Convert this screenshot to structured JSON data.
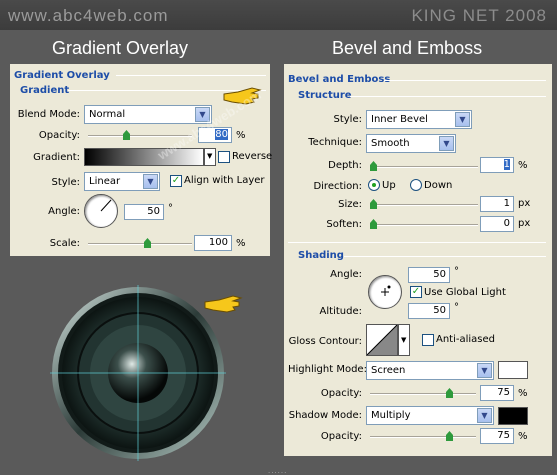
{
  "header": {
    "site": "www.abc4web.com",
    "brand": "KING NET 2008"
  },
  "left_heading": "Gradient Overlay",
  "right_heading": "Bevel and Emboss",
  "gradient_panel": {
    "section_title": "Gradient Overlay",
    "subsection": "Gradient",
    "blend_mode_label": "Blend Mode:",
    "blend_mode_value": "Normal",
    "opacity_label": "Opacity:",
    "opacity_value": "80",
    "opacity_fraction": 0.8,
    "gradient_label": "Gradient:",
    "reverse_label": "Reverse",
    "reverse_checked": false,
    "style_label": "Style:",
    "style_value": "Linear",
    "align_label": "Align with Layer",
    "align_checked": true,
    "angle_label": "Angle:",
    "angle_value": "50",
    "scale_label": "Scale:",
    "scale_value": "100",
    "pct": "%",
    "deg": "°"
  },
  "bevel_panel": {
    "section_title": "Bevel and Emboss",
    "structure": "Structure",
    "style_label": "Style:",
    "style_value": "Inner Bevel",
    "technique_label": "Technique:",
    "technique_value": "Smooth",
    "depth_label": "Depth:",
    "depth_value": "1",
    "direction_label": "Direction:",
    "dir_up": "Up",
    "dir_down": "Down",
    "direction_selected": "Up",
    "size_label": "Size:",
    "size_value": "1",
    "soften_label": "Soften:",
    "soften_value": "0",
    "px": "px",
    "shading": "Shading",
    "angle_label": "Angle:",
    "angle_value": "50",
    "global_light_label": "Use Global Light",
    "global_light_checked": true,
    "altitude_label": "Altitude:",
    "altitude_value": "50",
    "gloss_label": "Gloss Contour:",
    "anti_aliased_label": "Anti-aliased",
    "anti_aliased_checked": false,
    "highlight_mode_label": "Highlight Mode:",
    "highlight_mode_value": "Screen",
    "highlight_color": "#ffffff",
    "hl_opacity_label": "Opacity:",
    "hl_opacity_value": "75",
    "shadow_mode_label": "Shadow Mode:",
    "shadow_mode_value": "Multiply",
    "shadow_color": "#000000",
    "sh_opacity_label": "Opacity:",
    "sh_opacity_value": "75",
    "pct": "%",
    "deg": "°"
  },
  "watermark": "www.abc4web.com",
  "footer": "......"
}
